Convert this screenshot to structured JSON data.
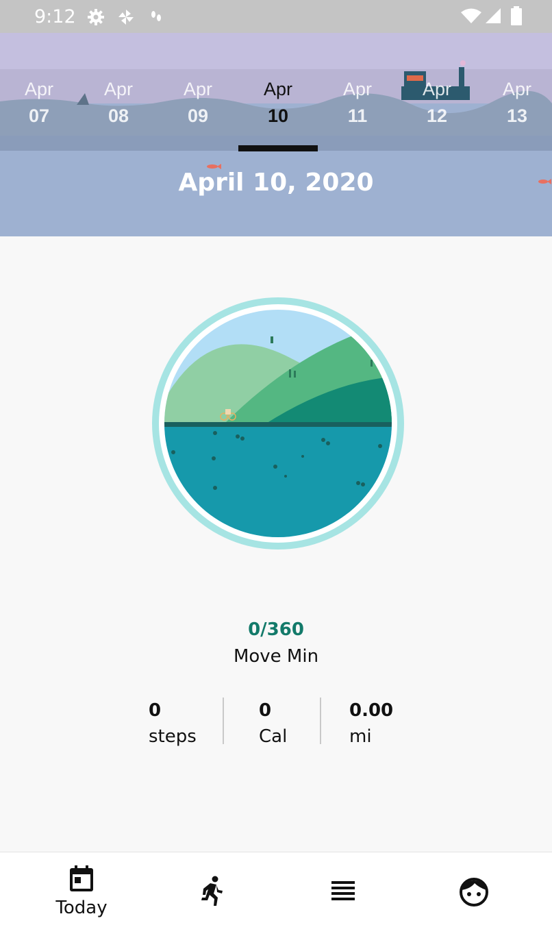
{
  "status_bar": {
    "time": "9:12",
    "left_icons": [
      "gear-icon",
      "pinwheel-icon",
      "footprints-icon"
    ],
    "right_icons": [
      "wifi-icon",
      "signal-icon",
      "battery-icon"
    ]
  },
  "date_strip": {
    "items": [
      {
        "month": "Apr",
        "day": "07"
      },
      {
        "month": "Apr",
        "day": "08"
      },
      {
        "month": "Apr",
        "day": "09"
      },
      {
        "month": "Apr",
        "day": "10"
      },
      {
        "month": "Apr",
        "day": "11"
      },
      {
        "month": "Apr",
        "day": "12"
      },
      {
        "month": "Apr",
        "day": "13"
      }
    ],
    "selected_index": 3
  },
  "header": {
    "full_date": "April 10, 2020"
  },
  "move": {
    "value": "0/360",
    "label": "Move Min"
  },
  "stats": [
    {
      "value": "0",
      "unit": "steps"
    },
    {
      "value": "0",
      "unit": "Cal"
    },
    {
      "value": "0.00",
      "unit": "mi"
    }
  ],
  "bottom_nav": {
    "items": [
      {
        "label": "Today",
        "icon": "calendar-icon"
      },
      {
        "label": "",
        "icon": "running-icon"
      },
      {
        "label": "",
        "icon": "list-icon"
      },
      {
        "label": "",
        "icon": "face-icon"
      }
    ],
    "active_index": 0
  },
  "colors": {
    "accent_green": "#137a6a",
    "ring": "#a6e4e3",
    "status_bar": "#c4c4c4"
  }
}
